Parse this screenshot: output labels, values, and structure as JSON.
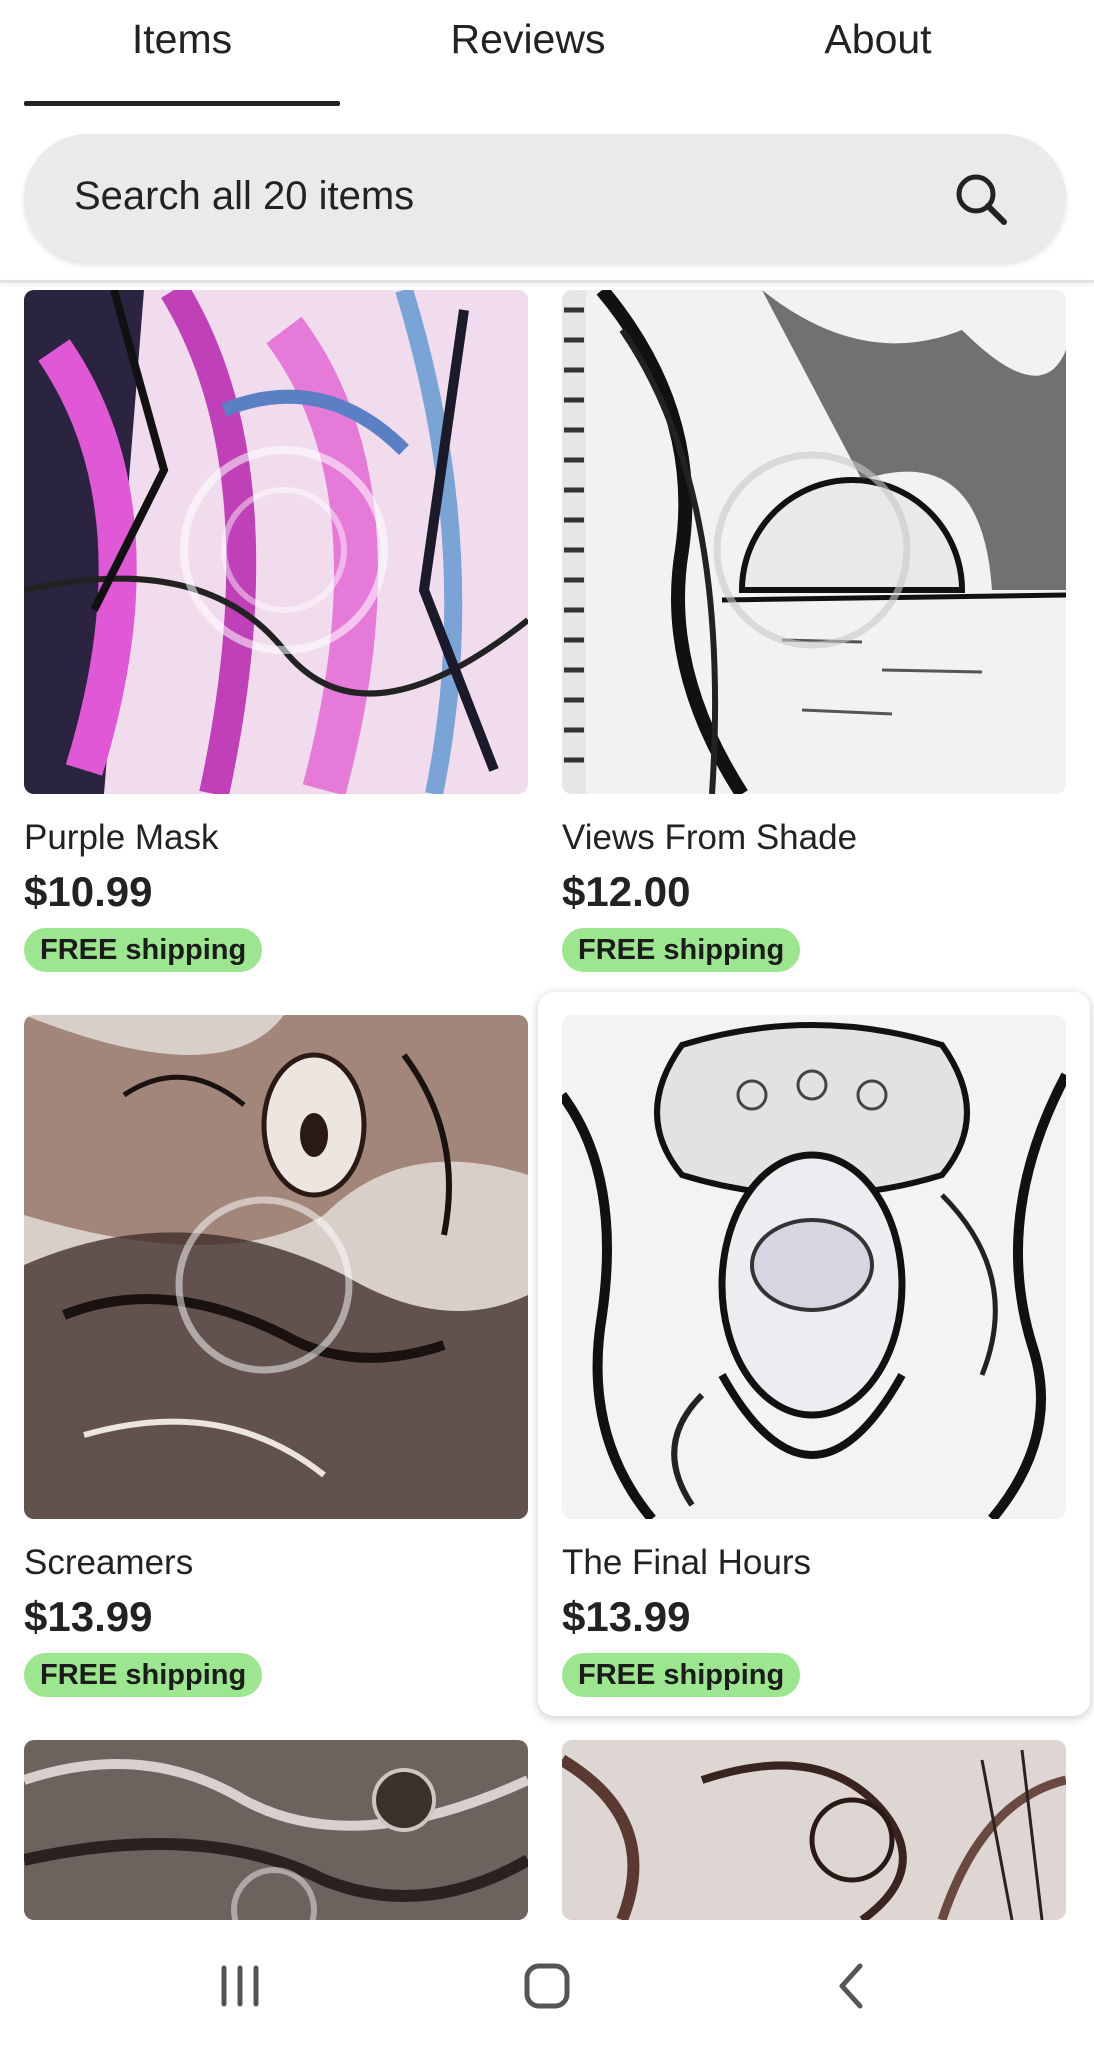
{
  "tabs": [
    {
      "label": "Items",
      "active": true
    },
    {
      "label": "Reviews",
      "active": false
    },
    {
      "label": "About",
      "active": false
    }
  ],
  "search": {
    "placeholder": "Search all 20 items",
    "icon": "search-icon"
  },
  "listings": [
    {
      "title": "Purple Mask",
      "price": "$10.99",
      "shipping": "FREE shipping"
    },
    {
      "title": "Views From Shade",
      "price": "$12.00",
      "shipping": "FREE shipping"
    },
    {
      "title": "Screamers",
      "price": "$13.99",
      "shipping": "FREE shipping"
    },
    {
      "title": "The Final Hours",
      "price": "$13.99",
      "shipping": "FREE shipping"
    }
  ],
  "colors": {
    "shipping_badge": "#9be68f",
    "search_bg": "#eaeaea",
    "text": "#222222"
  },
  "system_nav": {
    "icons": [
      "recent-apps-icon",
      "home-icon",
      "back-icon"
    ]
  }
}
